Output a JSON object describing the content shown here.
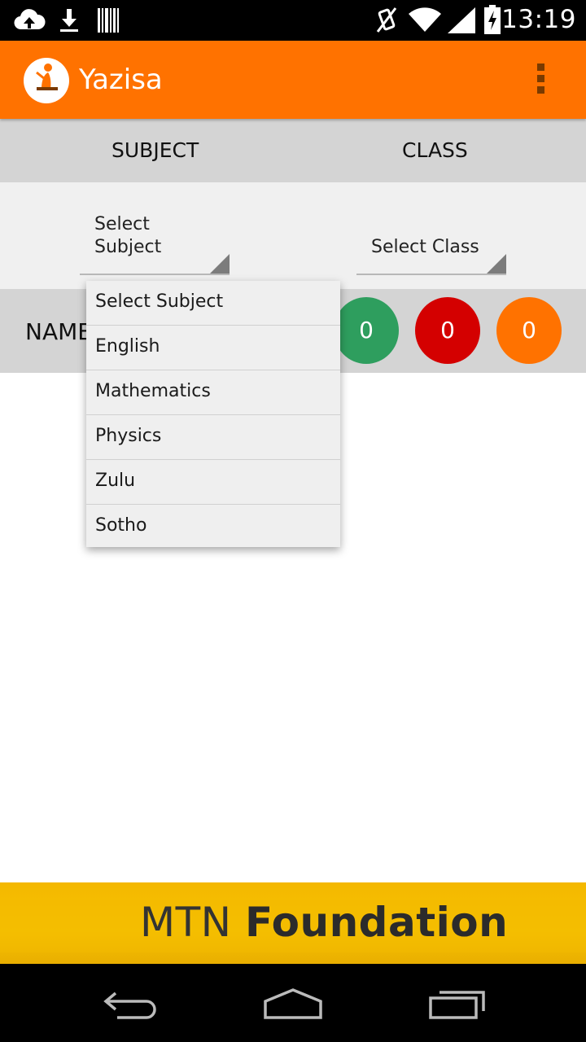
{
  "status_bar": {
    "time": "13:19",
    "icons": [
      "cloud-upload-icon",
      "download-icon",
      "barcode-icon",
      "vibrate-icon",
      "wifi-icon",
      "signal-icon",
      "battery-charging-icon"
    ]
  },
  "app_bar": {
    "title": "Yazisa",
    "logo_text": "Yazisa",
    "overflow_icon": "overflow-menu-icon"
  },
  "header": {
    "subject": "SUBJECT",
    "class": "CLASS"
  },
  "selectors": {
    "subject_value": "Select Subject",
    "class_value": "Select Class"
  },
  "name_row": {
    "label": "NAME",
    "counters": [
      {
        "value": "0",
        "color": "#2e9e5e"
      },
      {
        "value": "0",
        "color": "#d40000"
      },
      {
        "value": "0",
        "color": "#ff7200"
      }
    ]
  },
  "dropdown": {
    "options": [
      "Select Subject",
      "English",
      "Mathematics",
      "Physics",
      "Zulu",
      "Sotho"
    ]
  },
  "banner": {
    "brand": "MTN",
    "word": "Foundation"
  },
  "nav_bar": {
    "icons": [
      "back-icon",
      "home-icon",
      "recent-apps-icon"
    ]
  },
  "colors": {
    "accent": "#ff7200",
    "header_gray": "#d4d4d4",
    "selector_bg": "#f0f0f0"
  }
}
